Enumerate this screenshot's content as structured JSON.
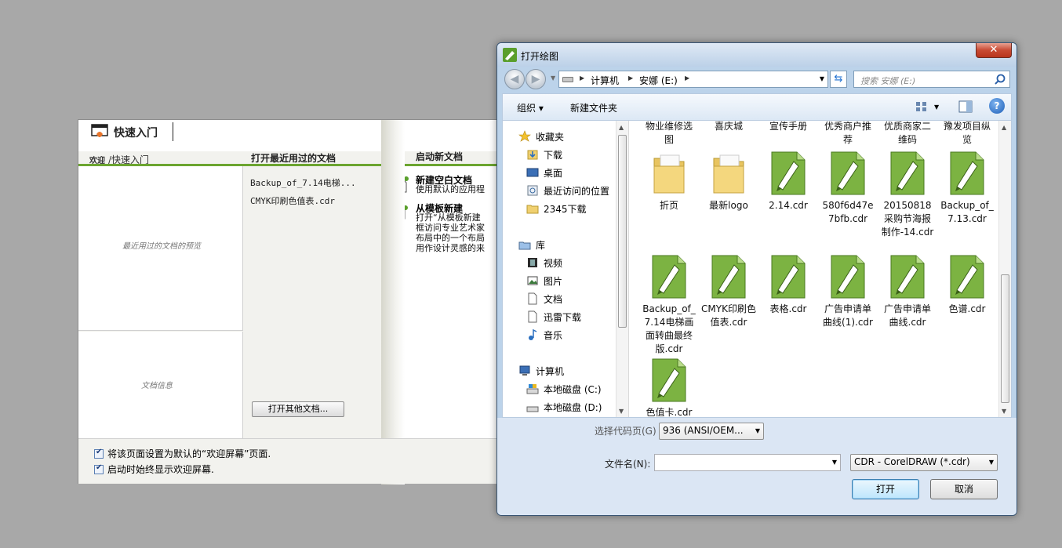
{
  "welcome": {
    "title": "快速入门",
    "crumb_home": "欢迎",
    "crumb_current": "/快速入门",
    "recent_heading": "打开最近用过的文档",
    "new_heading": "启动新文档",
    "recent_files": [
      "Backup_of_7.14电梯...",
      "CMYK印刷色值表.cdr"
    ],
    "preview_placeholder": "最近用过的文档的预览",
    "docinfo_placeholder": "文档信息",
    "open_other_button": "打开其他文档...",
    "new_blank_title": "新建空白文档",
    "new_blank_desc": "使用默认的应用程",
    "from_template_title": "从模板新建",
    "from_template_desc": [
      "打开“从模板新建",
      "框访问专业艺术家",
      "布局中的一个布局",
      "用作设计灵感的来"
    ],
    "checkbox_default_page": "将该页面设置为默认的“欢迎屏幕”页面.",
    "checkbox_always_show": "启动时始终显示欢迎屏幕."
  },
  "dialog": {
    "title": "打开绘图",
    "close_glyph": "✕",
    "address": [
      "计算机",
      "安娜 (E:)"
    ],
    "search_placeholder": "搜索 安娜 (E:)",
    "toolbar": {
      "organize": "组织 ▾",
      "new_folder": "新建文件夹"
    },
    "nav": {
      "favorites": {
        "label": "收藏夹",
        "items": [
          "下载",
          "桌面",
          "最近访问的位置",
          "2345下载"
        ]
      },
      "libraries": {
        "label": "库",
        "items": [
          "视频",
          "图片",
          "文档",
          "迅雷下载",
          "音乐"
        ]
      },
      "computer": {
        "label": "计算机",
        "items": [
          "本地磁盘 (C:)",
          "本地磁盘 (D:)"
        ]
      }
    },
    "top_row_labels": [
      "物业维修选图",
      "喜庆城",
      "宣传手册",
      "优秀商户推荐",
      "优质商家二维码",
      "豫发项目纵览"
    ],
    "files": [
      {
        "name": "折页",
        "kind": "folder"
      },
      {
        "name": "最新logo",
        "kind": "folder"
      },
      {
        "name": "2.14.cdr",
        "kind": "cdr"
      },
      {
        "name": "580f6d47e7bfb.cdr",
        "kind": "cdr"
      },
      {
        "name": "20150818采购节海报制作-14.cdr",
        "kind": "cdr"
      },
      {
        "name": "Backup_of_7.13.cdr",
        "kind": "cdr"
      },
      {
        "name": "Backup_of_7.14电梯画面转曲最终版.cdr",
        "kind": "cdr"
      },
      {
        "name": "CMYK印刷色值表.cdr",
        "kind": "cdr"
      },
      {
        "name": "表格.cdr",
        "kind": "cdr"
      },
      {
        "name": "广告申请单曲线(1).cdr",
        "kind": "cdr"
      },
      {
        "name": "广告申请单曲线.cdr",
        "kind": "cdr"
      },
      {
        "name": "色谱.cdr",
        "kind": "cdr"
      },
      {
        "name": "色值卡.cdr",
        "kind": "cdr"
      }
    ],
    "footer": {
      "codepage_label": "选择代码页(G)",
      "codepage_value": "936   (ANSI/OEM...",
      "filename_label": "文件名(N):",
      "filename_value": "",
      "filetype_value": "CDR - CorelDRAW (*.cdr)",
      "open_button": "打开",
      "cancel_button": "取消"
    }
  },
  "colors": {
    "accent_green": "#6ca530",
    "cdr_green": "#7cb342",
    "folder_yellow": "#f0d070",
    "close_red": "#c84a33"
  }
}
